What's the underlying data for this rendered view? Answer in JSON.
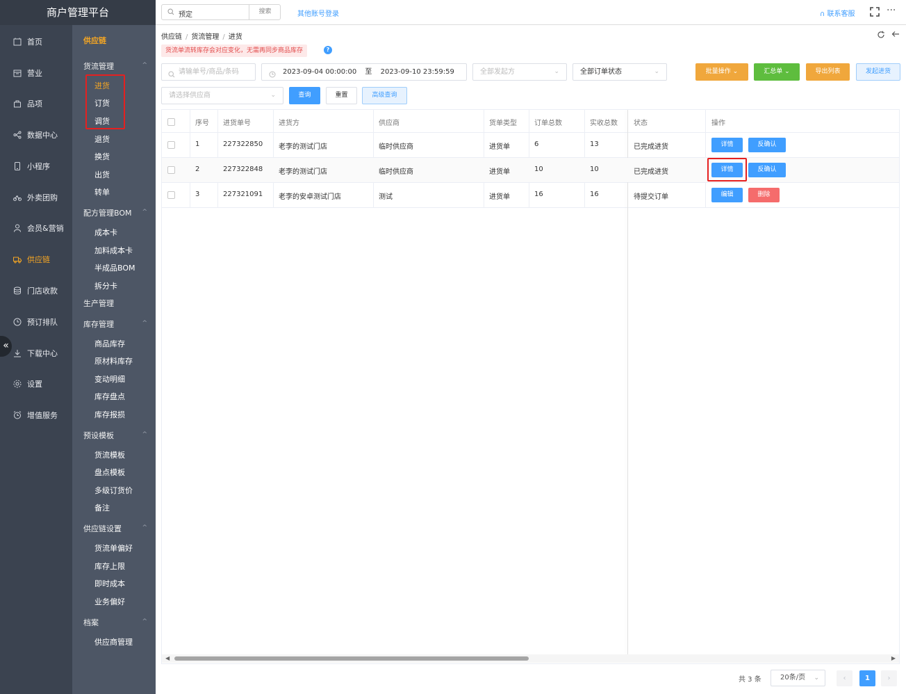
{
  "app": {
    "title": "商户管理平台"
  },
  "topbar": {
    "search_value": "预定",
    "search_button": "搜索",
    "other_login": "其他账号登录",
    "contact": "联系客服",
    "more": "···"
  },
  "nav": {
    "items": [
      {
        "label": "首页",
        "icon": "home-icon"
      },
      {
        "label": "营业",
        "icon": "calendar-icon"
      },
      {
        "label": "品项",
        "icon": "bag-icon"
      },
      {
        "label": "数据中心",
        "icon": "share-icon"
      },
      {
        "label": "小程序",
        "icon": "phone-icon"
      },
      {
        "label": "外卖团购",
        "icon": "bike-icon"
      },
      {
        "label": "会员&营销",
        "icon": "user-icon"
      },
      {
        "label": "供应链",
        "icon": "truck-icon",
        "active": true
      },
      {
        "label": "门店收款",
        "icon": "coins-icon"
      },
      {
        "label": "预订排队",
        "icon": "clock-icon"
      },
      {
        "label": "下载中心",
        "icon": "download-icon"
      },
      {
        "label": "设置",
        "icon": "gear-icon"
      },
      {
        "label": "增值服务",
        "icon": "alarm-icon"
      }
    ],
    "collapse": "«"
  },
  "subnav": {
    "title": "供应链",
    "groups": {
      "g1": "货流管理",
      "g2": "配方管理BOM",
      "g3": "生产管理",
      "g4": "库存管理",
      "g5": "预设模板",
      "g6": "供应链设置",
      "g7": "档案"
    },
    "items": {
      "i1": "进货",
      "i2": "订货",
      "i3": "调货",
      "i4": "退货",
      "i5": "换货",
      "i6": "出货",
      "i7": "转单",
      "i8": "成本卡",
      "i9": "加料成本卡",
      "i10": "半成品BOM",
      "i11": "拆分卡",
      "i12": "商品库存",
      "i13": "原材料库存",
      "i14": "变动明细",
      "i15": "库存盘点",
      "i16": "库存报损",
      "i17": "货流模板",
      "i18": "盘点模板",
      "i19": "多级订货价",
      "i20": "备注",
      "i21": "货流单偏好",
      "i22": "库存上限",
      "i23": "即时成本",
      "i24": "业务偏好",
      "i25": "供应商管理"
    },
    "caret": "^"
  },
  "breadcrumb": {
    "a": "供应链",
    "b": "货流管理",
    "c": "进货",
    "sep": "/"
  },
  "notice": {
    "text": "货流单流转库存会对应变化，无需再同步商品库存",
    "help": "?"
  },
  "filters": {
    "order_search_placeholder": "请输单号/商品/条码",
    "date_start": "2023-09-04 00:00:00",
    "date_to": "至",
    "date_end": "2023-09-10 23:59:59",
    "initiator_placeholder": "全部发起方",
    "status_value": "全部订单状态",
    "supplier_placeholder": "请选择供应商",
    "query": "查询",
    "reset": "重置",
    "advanced": "高级查询",
    "batch": "批量操作",
    "summary": "汇总单",
    "export": "导出列表",
    "create": "发起进货",
    "chevron": "⌄"
  },
  "table": {
    "headers": {
      "seq": "序号",
      "order_no": "进货单号",
      "purchaser": "进货方",
      "supplier": "供应商",
      "type": "货单类型",
      "order_total": "订单总数",
      "received_total": "实收总数",
      "status": "状态",
      "ops": "操作"
    },
    "rows": [
      {
        "seq": "1",
        "order_no": "227322850",
        "purchaser": "老李的测试门店",
        "supplier": "临时供应商",
        "type": "进货单",
        "order_total": "6",
        "received_total": "13",
        "status": "已完成进货",
        "btn1": "详情",
        "btn2": "反确认"
      },
      {
        "seq": "2",
        "order_no": "227322848",
        "purchaser": "老李的测试门店",
        "supplier": "临时供应商",
        "type": "进货单",
        "order_total": "10",
        "received_total": "10",
        "status": "已完成进货",
        "btn1": "详情",
        "btn2": "反确认"
      },
      {
        "seq": "3",
        "order_no": "227321091",
        "purchaser": "老李的安卓测试门店",
        "supplier": "测试",
        "type": "进货单",
        "order_total": "16",
        "received_total": "16",
        "status": "待提交订单",
        "btn1": "编辑",
        "btn2": "删除"
      }
    ]
  },
  "pagination": {
    "total": "共 3 条",
    "page_size": "20条/页",
    "prev": "‹",
    "current": "1",
    "next": "›"
  },
  "colors": {
    "accent": "#409eff",
    "active_nav": "#f5a623",
    "highlight_box": "#e52020",
    "danger": "#f56c6c"
  }
}
